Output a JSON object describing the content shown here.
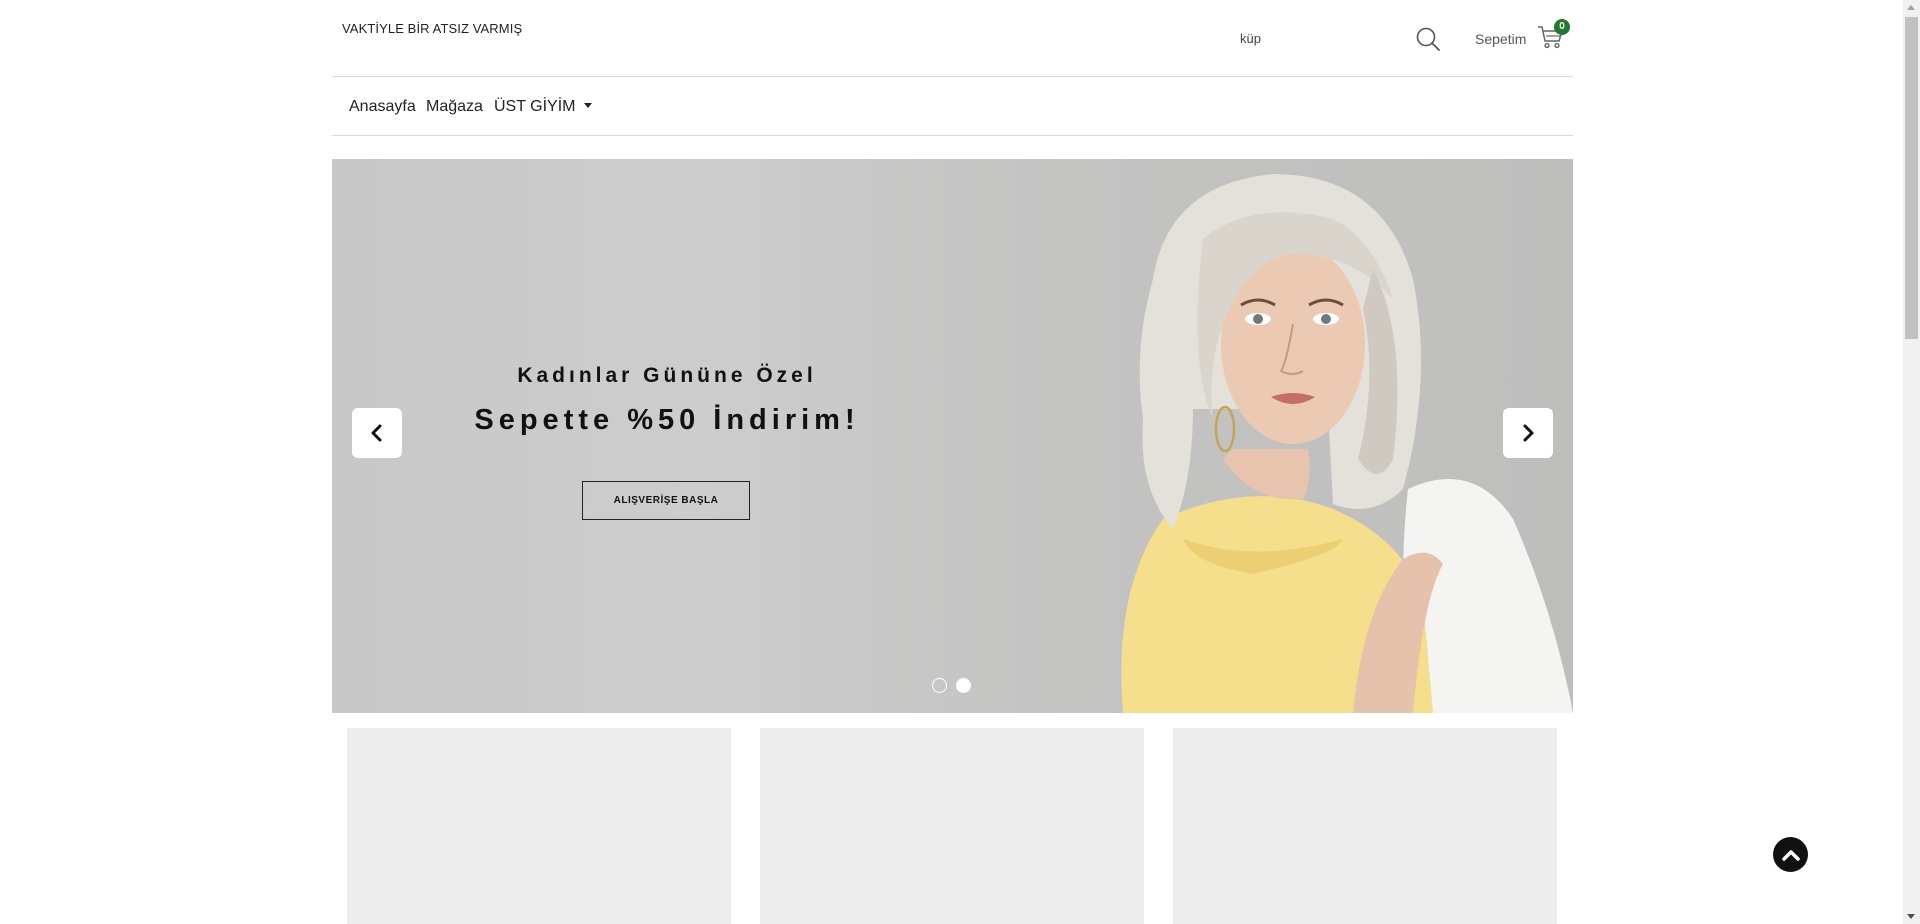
{
  "header": {
    "logo_text": "VAKTİYLE BİR ATSIZ VARMIŞ",
    "search_value": "küp",
    "cart_label": "Sepetim",
    "cart_count": "0"
  },
  "nav": {
    "items": [
      {
        "label": "Anasayfa"
      },
      {
        "label": "Mağaza"
      },
      {
        "label": "ÜST GİYİM",
        "has_dropdown": true
      }
    ]
  },
  "hero": {
    "subtitle": "Kadınlar Gününe Özel",
    "title": "Sepette %50 İndirim!",
    "cta_label": "ALIŞVERİŞE BAŞLA",
    "slide_count": 2,
    "active_slide": 2
  },
  "colors": {
    "badge": "#1e7a2e",
    "hero_background": "#c8c8c8",
    "card_placeholder": "#ededed",
    "accent": "#111111"
  },
  "icons": [
    "search-icon",
    "cart-icon",
    "chevron-left-icon",
    "chevron-right-icon",
    "chevron-up-icon",
    "caret-down-icon"
  ]
}
